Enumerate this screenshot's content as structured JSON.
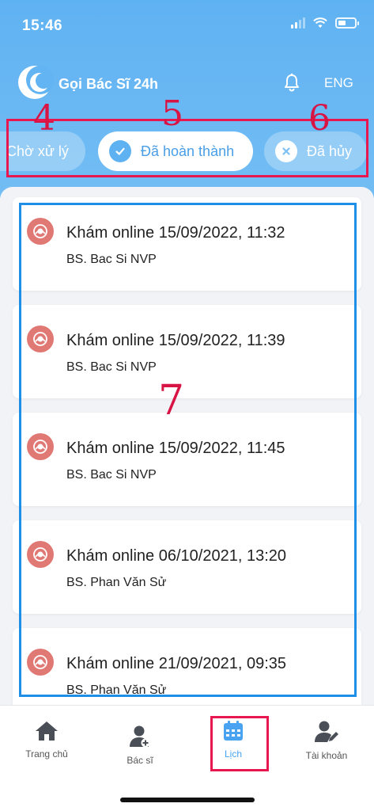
{
  "status_bar": {
    "time": "15:46"
  },
  "app_bar": {
    "title": "Gọi Bác Sĩ 24h",
    "language": "ENG"
  },
  "tabs": [
    {
      "label": "Chờ xử lý",
      "selected": false
    },
    {
      "label": "Đã hoàn thành",
      "selected": true
    },
    {
      "label": "Đã hủy",
      "selected": false
    }
  ],
  "annotations": {
    "tabs_left": "4",
    "tabs_middle": "5",
    "tabs_right": "6",
    "list": "7"
  },
  "appointments": [
    {
      "title": "Khám online 15/09/2022, 11:32",
      "doctor": "BS. Bac Si NVP"
    },
    {
      "title": "Khám online 15/09/2022, 11:39",
      "doctor": "BS. Bac Si NVP"
    },
    {
      "title": "Khám online 15/09/2022, 11:45",
      "doctor": "BS. Bac Si NVP"
    },
    {
      "title": "Khám online 06/10/2021, 13:20",
      "doctor": "BS. Phan Văn Sử"
    },
    {
      "title": "Khám online 21/09/2021, 09:35",
      "doctor": "BS. Phan Văn Sử"
    }
  ],
  "bottom_nav": [
    {
      "label": "Trang chủ",
      "icon": "home-icon"
    },
    {
      "label": "Bác sĩ",
      "icon": "doctor-icon"
    },
    {
      "label": "Lịch",
      "icon": "calendar-icon",
      "active": true
    },
    {
      "label": "Tài khoản",
      "icon": "account-icon"
    }
  ],
  "colors": {
    "header": "#5fb2f2",
    "accent": "#4aa3f0",
    "card_icon": "#e07874",
    "annotation_red": "#e8174f",
    "annotation_blue": "#1e8fe6"
  }
}
